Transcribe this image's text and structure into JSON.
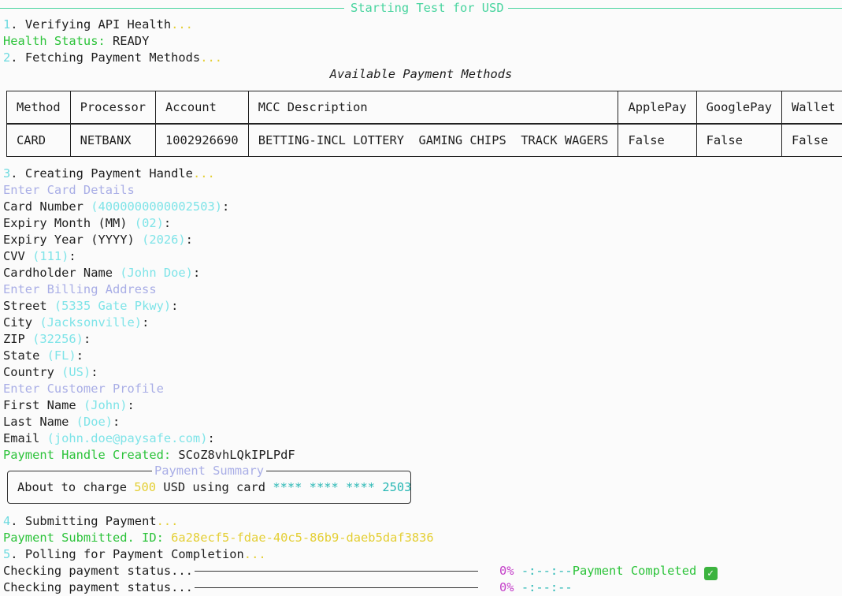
{
  "header": {
    "title": "Starting Test for USD"
  },
  "steps": {
    "s1": {
      "num": "1",
      "text": ". Verifying API Health",
      "ellipsis": "..."
    },
    "s2": {
      "num": "2",
      "text": ". Fetching Payment Methods",
      "ellipsis": "..."
    },
    "s3": {
      "num": "3",
      "text": ". Creating Payment Handle",
      "ellipsis": "..."
    },
    "s4": {
      "num": "4",
      "text": ". Submitting Payment",
      "ellipsis": "..."
    },
    "s5": {
      "num": "5",
      "text": ". Polling for Payment Completion",
      "ellipsis": "..."
    }
  },
  "health": {
    "label": "Health Status:",
    "value": " READY"
  },
  "payment_methods": {
    "caption": "Available Payment Methods",
    "headers": [
      "Method",
      "Processor",
      "Account",
      "MCC Description",
      "ApplePay",
      "GooglePay",
      "Wallet"
    ],
    "rows": [
      [
        "CARD",
        "NETBANX",
        "1002926690",
        "BETTING-INCL LOTTERY  GAMING CHIPS  TRACK WAGERS",
        "False",
        "False",
        "False"
      ]
    ]
  },
  "card_section": {
    "heading": "Enter Card Details",
    "fields": [
      {
        "label": "Card Number ",
        "default": "(4000000000002503)",
        "suffix": ":"
      },
      {
        "label": "Expiry Month (MM) ",
        "default": "(02)",
        "suffix": ":"
      },
      {
        "label": "Expiry Year (YYYY) ",
        "default": "(2026)",
        "suffix": ":"
      },
      {
        "label": "CVV ",
        "default": "(111)",
        "suffix": ":"
      },
      {
        "label": "Cardholder Name ",
        "default": "(John Doe)",
        "suffix": ":"
      }
    ]
  },
  "billing_section": {
    "heading": "Enter Billing Address",
    "fields": [
      {
        "label": "Street ",
        "default": "(5335 Gate Pkwy)",
        "suffix": ":"
      },
      {
        "label": "City ",
        "default": "(Jacksonville)",
        "suffix": ":"
      },
      {
        "label": "ZIP ",
        "default": "(32256)",
        "suffix": ":"
      },
      {
        "label": "State ",
        "default": "(FL)",
        "suffix": ":"
      },
      {
        "label": "Country ",
        "default": "(US)",
        "suffix": ":"
      }
    ]
  },
  "customer_section": {
    "heading": "Enter Customer Profile",
    "fields": [
      {
        "label": "First Name ",
        "default": "(John)",
        "suffix": ":"
      },
      {
        "label": "Last Name ",
        "default": "(Doe)",
        "suffix": ":"
      },
      {
        "label": "Email ",
        "default": "(john.doe@paysafe.com)",
        "suffix": ":"
      }
    ]
  },
  "handle": {
    "label": "Payment Handle Created:",
    "value": " SCoZ8vhLQkIPLPdF"
  },
  "summary": {
    "title": "Payment Summary",
    "prefix": "About to charge ",
    "amount": "500",
    "middle": " USD using card ",
    "masked": "**** **** ****",
    "last4": " 2503"
  },
  "submitted": {
    "label": "Payment Submitted. ID:",
    "id": " 6a28ecf5-fdae-40c5-86b9-daeb5daf3836"
  },
  "polling": [
    {
      "label": "Checking payment status...",
      "percent": "0%",
      "eta": "-:--:--",
      "result": "Payment Completed",
      "progress": 0
    },
    {
      "label": "Checking payment status...",
      "percent": "0%",
      "eta": "-:--:--",
      "result": "",
      "progress": 0
    }
  ]
}
